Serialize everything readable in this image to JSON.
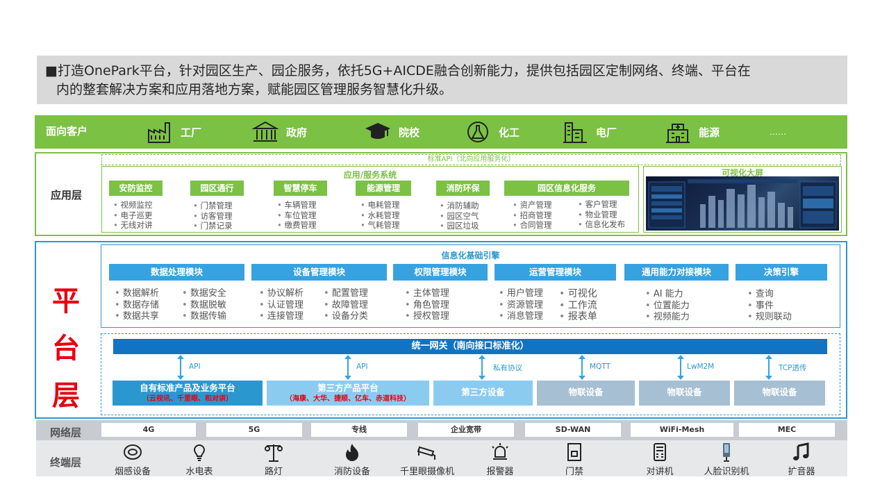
{
  "intro": {
    "line1": "■打造OnePark平台，针对园区生产、园企服务，依托5G+AICDE融合创新能力，提供包括园区定制网络、终端、平台在",
    "line2": "内的整套解决方案和应用落地方案，赋能园区管理服务智慧化升级。"
  },
  "customers": {
    "title": "面向客户",
    "items": [
      "工厂",
      "政府",
      "院校",
      "化工",
      "电厂",
      "能源",
      "……"
    ]
  },
  "app_layer": {
    "label": "应用层",
    "api_bar": "标准API（北向应用服务化）",
    "box_title": "应用/服务系统",
    "modules": [
      {
        "name": "安防监控",
        "items": [
          "视频监控",
          "电子巡更",
          "无线对讲"
        ]
      },
      {
        "name": "园区通行",
        "items": [
          "门禁管理",
          "访客管理",
          "门禁记录"
        ]
      },
      {
        "name": "智慧停车",
        "items": [
          "车辆管理",
          "车位管理",
          "缴费管理"
        ]
      },
      {
        "name": "能源管理",
        "items": [
          "电耗管理",
          "水耗管理",
          "气耗管理"
        ]
      },
      {
        "name": "消防环保",
        "items": [
          "消防辅助",
          "园区空气",
          "园区垃圾"
        ]
      },
      {
        "name": "园区信息化服务",
        "items": [
          "资产管理",
          "招商管理",
          "合同管理"
        ],
        "items2": [
          "客户管理",
          "物业管理",
          "信息化发布"
        ]
      }
    ],
    "vis_title": "可视化大屏"
  },
  "platform": {
    "label_chars": [
      "平",
      "台",
      "层"
    ],
    "engine_title": "信息化基础引擎",
    "modules": [
      {
        "name": "数据处理模块",
        "col1": [
          "数据解析",
          "数据存储",
          "数据共享"
        ],
        "col2": [
          "数据安全",
          "数据脱敏",
          "数据传输"
        ]
      },
      {
        "name": "设备管理模块",
        "col1": [
          "协议解析",
          "认证管理",
          "连接管理"
        ],
        "col2": [
          "配置管理",
          "故障管理",
          "设备分类"
        ]
      },
      {
        "name": "权限管理模块",
        "col1": [
          "主体管理",
          "角色管理",
          "授权管理"
        ]
      },
      {
        "name": "运营管理模块",
        "col1": [
          "用户管理",
          "资源管理",
          "消息管理"
        ],
        "col2": [
          "可视化",
          "工作流",
          "报表单"
        ]
      },
      {
        "name": "通用能力对接模块",
        "col1": [
          "AI 能力",
          "位置能力",
          "视频能力"
        ]
      },
      {
        "name": "决策引擎",
        "col1": [
          "查询",
          "事件",
          "规则联动"
        ]
      }
    ],
    "gateway": "统一网关（南向接口标准化）",
    "protocols": [
      "API",
      "API",
      "私有协议",
      "MQTT",
      "LwM2M",
      "TCP透传"
    ],
    "bottom": [
      {
        "title": "自有标准产品及业务平台",
        "sub": "（云视讯、千里眼、和对讲）"
      },
      {
        "title": "第三方产品平台",
        "sub": "（海康、大华、捷顺、亿车、赤道科技）"
      },
      {
        "title": "第三方设备",
        "sub": ""
      },
      {
        "title": "物联设备",
        "sub": ""
      },
      {
        "title": "物联设备",
        "sub": ""
      },
      {
        "title": "物联设备",
        "sub": ""
      }
    ]
  },
  "network": {
    "label": "网络层",
    "items": [
      "4G",
      "5G",
      "专线",
      "企业宽带",
      "SD-WAN",
      "WiFi-Mesh",
      "MEC"
    ]
  },
  "terminal": {
    "label": "终端层",
    "items": [
      "烟感设备",
      "水电表",
      "路灯",
      "消防设备",
      "千里眼摄像机",
      "报警器",
      "门禁",
      "对讲机",
      "人脸识别机",
      "扩音器"
    ]
  },
  "colors": {
    "green": "#7bc144",
    "blue": "#2a98cf",
    "red": "#e60012",
    "dark_blue": "#1273c2"
  }
}
